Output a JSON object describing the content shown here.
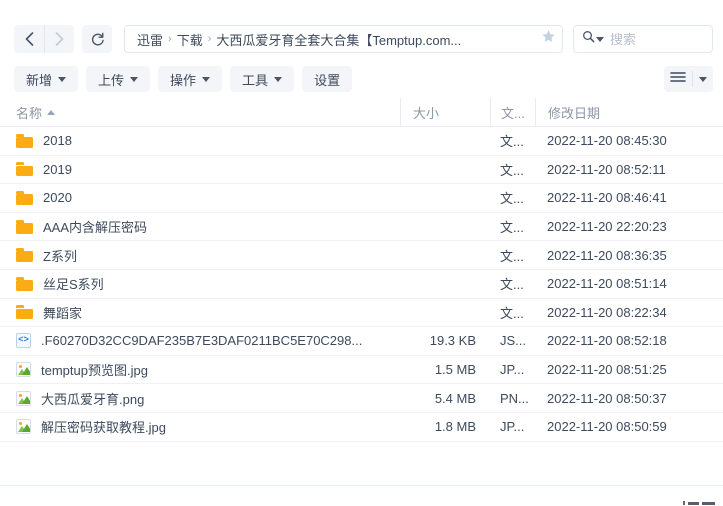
{
  "nav": {
    "back_label": "后退",
    "forward_label": "前进",
    "refresh_label": "刷新"
  },
  "breadcrumb": {
    "items": [
      "迅雷",
      "下载"
    ],
    "separator": "›",
    "current": "大西瓜爱牙育全套大合集【Temptup.com...",
    "star_label": "收藏"
  },
  "search": {
    "placeholder": "搜索",
    "value": "",
    "icon": "search-icon"
  },
  "toolbar": {
    "buttons": [
      {
        "label": "新增",
        "has_caret": true
      },
      {
        "label": "上传",
        "has_caret": true
      },
      {
        "label": "操作",
        "has_caret": true
      },
      {
        "label": "工具",
        "has_caret": true
      },
      {
        "label": "设置",
        "has_caret": false
      }
    ],
    "view_menu_label": "视图"
  },
  "list": {
    "headers": {
      "name": "名称",
      "size": "大小",
      "type": "文...",
      "date": "修改日期"
    },
    "sort": {
      "column": "名称",
      "direction": "asc"
    },
    "rows": [
      {
        "icon": "folder-icon",
        "name": "2018",
        "size": "",
        "type": "文...",
        "date": "2022-11-20 08:45:30"
      },
      {
        "icon": "folder-icon",
        "name": "2019",
        "size": "",
        "type": "文...",
        "date": "2022-11-20 08:52:11"
      },
      {
        "icon": "folder-icon",
        "name": "2020",
        "size": "",
        "type": "文...",
        "date": "2022-11-20 08:46:41"
      },
      {
        "icon": "folder-icon",
        "name": "AAA内含解压密码",
        "size": "",
        "type": "文...",
        "date": "2022-11-20 22:20:23"
      },
      {
        "icon": "folder-icon",
        "name": "Z系列",
        "size": "",
        "type": "文...",
        "date": "2022-11-20 08:36:35"
      },
      {
        "icon": "folder-icon",
        "name": "丝足S系列",
        "size": "",
        "type": "文...",
        "date": "2022-11-20 08:51:14"
      },
      {
        "icon": "folder-icon",
        "name": "舞蹈家",
        "size": "",
        "type": "文...",
        "date": "2022-11-20 08:22:34"
      },
      {
        "icon": "code-file-icon",
        "name": ".F60270D32CC9DAF235B7E3DAF0211BC5E70C298...",
        "size": "19.3 KB",
        "type": "JS...",
        "date": "2022-11-20 08:52:18"
      },
      {
        "icon": "image-file-icon",
        "name": "temptup预览图.jpg",
        "size": "1.5 MB",
        "type": "JP...",
        "date": "2022-11-20 08:51:25"
      },
      {
        "icon": "image-file-icon",
        "name": "大西瓜爱牙育.png",
        "size": "5.4 MB",
        "type": "PN...",
        "date": "2022-11-20 08:50:37"
      },
      {
        "icon": "image-file-icon",
        "name": "解压密码获取教程.jpg",
        "size": "1.8 MB",
        "type": "JP...",
        "date": "2022-11-20 08:50:59"
      }
    ]
  },
  "colors": {
    "folder": "#fbab14",
    "accent": "#2f7bd6",
    "text": "#3d4a5c",
    "muted": "#8d97a5",
    "button_bg": "#f3f5f9",
    "border": "#e8ecf2"
  }
}
